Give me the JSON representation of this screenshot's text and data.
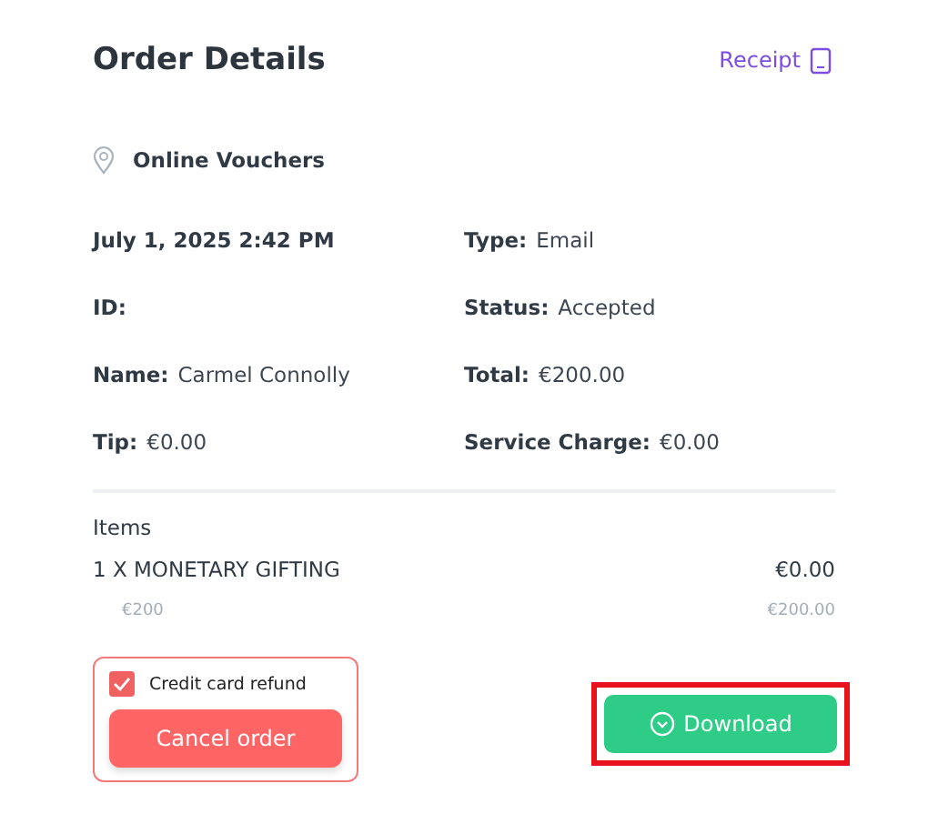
{
  "header": {
    "title": "Order Details",
    "receipt_link": "Receipt"
  },
  "location": "Online Vouchers",
  "details": [
    {
      "value": "July 1, 2025 2:42 PM"
    },
    {
      "label": "Type:",
      "value": "Email"
    },
    {
      "label": "ID:"
    },
    {
      "label": "Status:",
      "value": "Accepted"
    },
    {
      "label": "Name:",
      "value": "Carmel Connolly"
    },
    {
      "label": "Total:",
      "value": "€200.00"
    },
    {
      "label": "Tip:",
      "value": "€0.00"
    },
    {
      "label": "Service Charge:",
      "value": "€0.00"
    }
  ],
  "items": {
    "heading": "Items",
    "rows": [
      {
        "name": "1 X MONETARY GIFTING",
        "price": "€0.00",
        "unit_price": "€200",
        "subtotal": "€200.00"
      }
    ]
  },
  "refund": {
    "label": "Credit card refund",
    "checked": true
  },
  "buttons": {
    "cancel": "Cancel order",
    "download": "Download",
    "download_highlighted": true
  }
}
